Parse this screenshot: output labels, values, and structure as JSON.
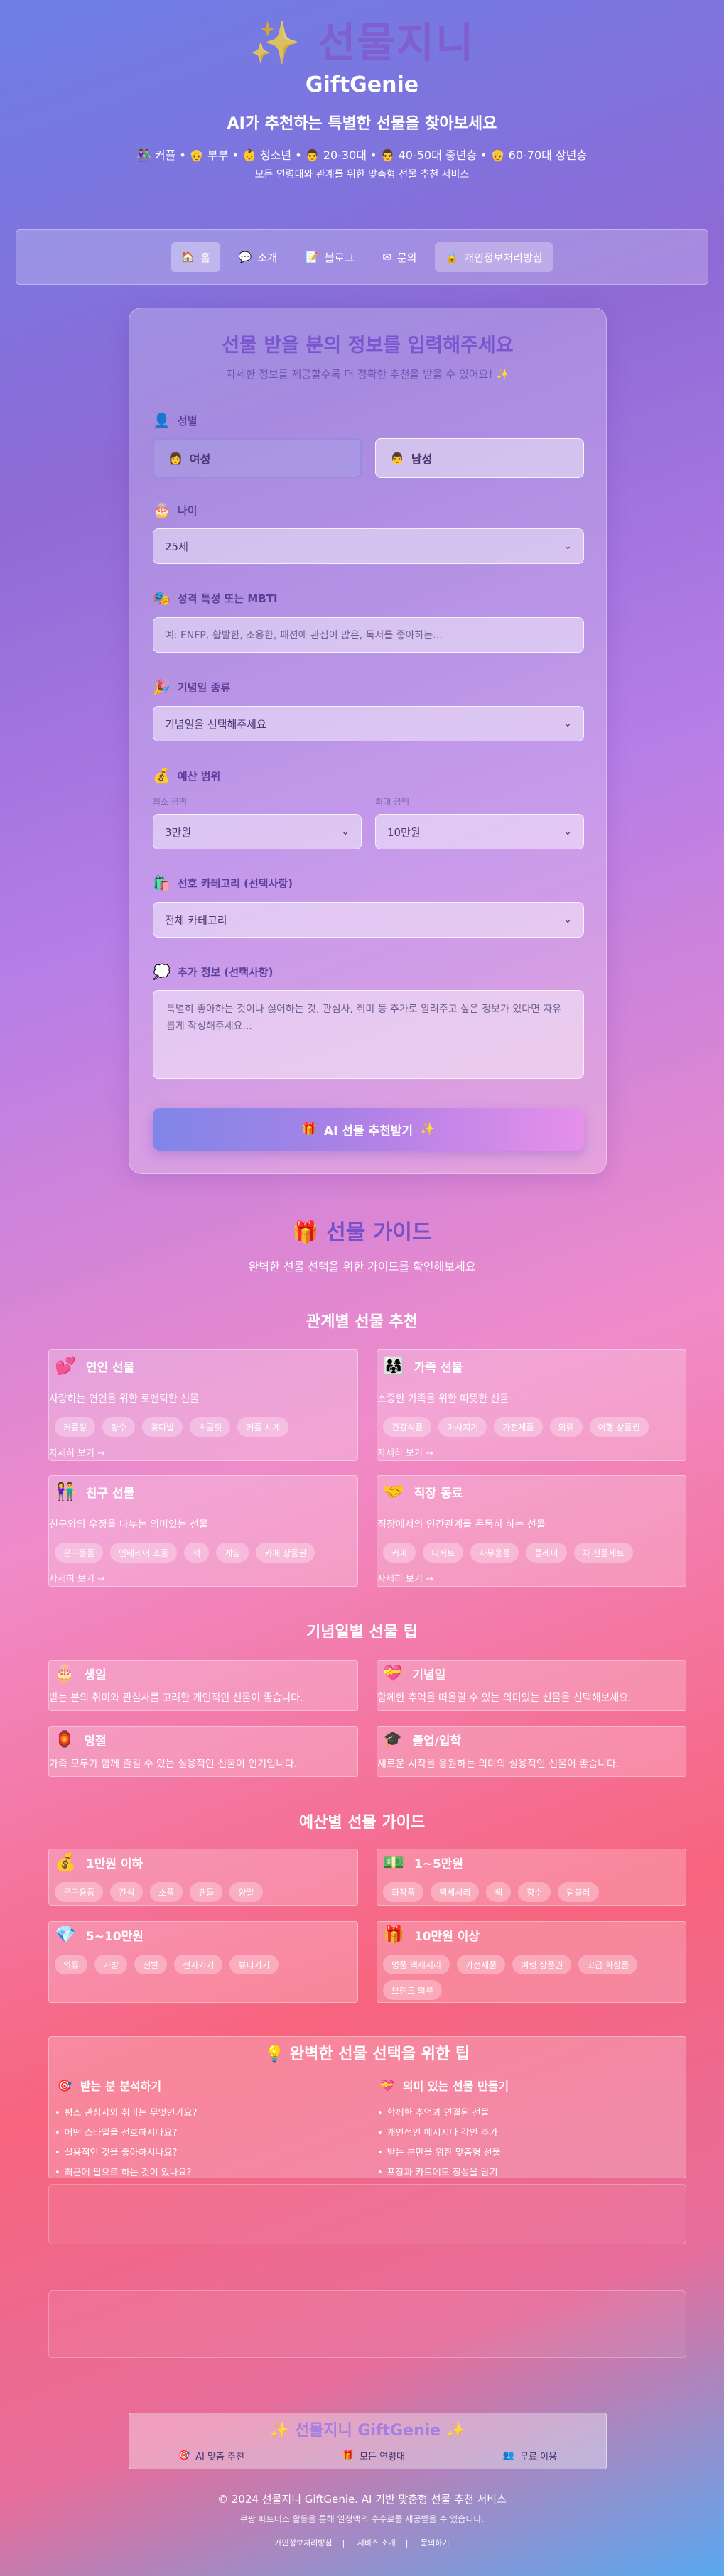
{
  "header": {
    "title": "선물지니",
    "subtitle": "GiftGenie",
    "tagline": "AI가 추천하는 특별한 선물을 찾아보세요",
    "targets": "👫 커플 • 👴 부부 • 👶 청소년 • 👨 20-30대 • 👨 40-50대 중년층 • 👴 60-70대 장년층",
    "targets_desc": "모든 연령대와 관계를 위한 맞춤형 선물 추천 서비스"
  },
  "nav": [
    {
      "icon": "🏠",
      "label": "홈"
    },
    {
      "icon": "💬",
      "label": "소개"
    },
    {
      "icon": "📝",
      "label": "블로그"
    },
    {
      "icon": "✉",
      "label": "문의"
    },
    {
      "icon": "🔒",
      "label": "개인정보처리방침"
    }
  ],
  "form": {
    "title": "선물 받을 분의 정보를 입력해주세요",
    "subtitle": "자세한 정보를 제공할수록 더 정확한 추천을 받을 수 있어요! ✨",
    "gender_label": "성별",
    "gender_female": "여성",
    "gender_male": "남성",
    "age_label": "나이",
    "age_value": "25세",
    "mbti_label": "성격 특성 또는 MBTI",
    "mbti_placeholder": "예: ENFP, 활발한, 조용한, 패션에 관심이 많은, 독서를 좋아하는...",
    "occasion_label": "기념일 종류",
    "occasion_value": "기념일을 선택해주세요",
    "budget_label": "예산 범위",
    "budget_min_label": "최소 금액",
    "budget_min_value": "3만원",
    "budget_max_label": "최대 금액",
    "budget_max_value": "10만원",
    "category_label": "선호 카테고리 (선택사항)",
    "category_value": "전체 카테고리",
    "extra_label": "추가 정보 (선택사항)",
    "extra_placeholder": "특별히 좋아하는 것이나 싫어하는 것, 관심사, 취미 등 추가로 알려주고 싶은 정보가 있다면 자유롭게 작성해주세요...",
    "submit_label": "AI 선물 추천받기"
  },
  "guide": {
    "title": "선물 가이드",
    "subtitle": "완벽한 선물 선택을 위한 가이드를 확인해보세요",
    "relation_title": "관계별 선물 추천",
    "relations": [
      {
        "icon": "💕",
        "name": "연인 선물",
        "desc": "사랑하는 연인을 위한 로맨틱한 선물",
        "tags": [
          "커플링",
          "향수",
          "꽃다발",
          "초콜릿",
          "커플 시계"
        ],
        "more": "자세히 보기 →"
      },
      {
        "icon": "👨‍👩‍👧",
        "name": "가족 선물",
        "desc": "소중한 가족을 위한 따뜻한 선물",
        "tags": [
          "건강식품",
          "마사지기",
          "가전제품",
          "의류",
          "여행 상품권"
        ],
        "more": "자세히 보기 →"
      },
      {
        "icon": "👫",
        "name": "친구 선물",
        "desc": "친구와의 우정을 나누는 의미있는 선물",
        "tags": [
          "문구용품",
          "인테리어 소품",
          "책",
          "게임",
          "카페 상품권"
        ],
        "more": "자세히 보기 →"
      },
      {
        "icon": "🤝",
        "name": "직장 동료",
        "desc": "직장에서의 인간관계를 돈독히 하는 선물",
        "tags": [
          "커피",
          "디저트",
          "사무용품",
          "플레너",
          "차 선물세트"
        ],
        "more": "자세히 보기 →"
      }
    ],
    "occasion_title": "기념일별 선물 팁",
    "occasions": [
      {
        "icon": "🎂",
        "name": "생일",
        "desc": "받는 분의 취미와 관심사를 고려한 개인적인 선물이 좋습니다."
      },
      {
        "icon": "💝",
        "name": "기념일",
        "desc": "함께한 추억을 떠올릴 수 있는 의미있는 선물을 선택해보세요."
      },
      {
        "icon": "🏮",
        "name": "명절",
        "desc": "가족 모두가 함께 즐길 수 있는 실용적인 선물이 인기입니다."
      },
      {
        "icon": "🎓",
        "name": "졸업/입학",
        "desc": "새로운 시작을 응원하는 의미의 실용적인 선물이 좋습니다."
      }
    ],
    "budget_title": "예산별 선물 가이드",
    "budgets": [
      {
        "icon": "💰",
        "name": "1만원 이하",
        "tags": [
          "문구용품",
          "간식",
          "소품",
          "캔들",
          "양말"
        ]
      },
      {
        "icon": "💵",
        "name": "1~5만원",
        "tags": [
          "화장품",
          "액세서리",
          "책",
          "향수",
          "텀블러"
        ]
      },
      {
        "icon": "💎",
        "name": "5~10만원",
        "tags": [
          "의류",
          "가방",
          "신발",
          "전자기기",
          "뷰티기기"
        ]
      },
      {
        "icon": "🎁",
        "name": "10만원 이상",
        "tags": [
          "명품 액세서리",
          "가전제품",
          "여행 상품권",
          "고급 화장품",
          "브랜드 의류"
        ]
      }
    ],
    "tips_title": "완벽한 선물 선택을 위한 팁",
    "tips_left_title": "받는 분 분석하기",
    "tips_left": [
      "평소 관심사와 취미는 무엇인가요?",
      "어떤 스타일을 선호하시나요?",
      "실용적인 것을 좋아하시나요?",
      "최근에 필요로 하는 것이 있나요?"
    ],
    "tips_right_title": "의미 있는 선물 만들기",
    "tips_right": [
      "함께한 추억과 연결된 선물",
      "개인적인 메시지나 각인 추가",
      "받는 분만을 위한 맞춤형 선물",
      "포장과 카드에도 정성을 담기"
    ]
  },
  "footer": {
    "title": "선물지니 GiftGenie",
    "links": [
      {
        "icon": "🎯",
        "label": "AI 맞춤 추천"
      },
      {
        "icon": "🎁",
        "label": "모든 연령대"
      },
      {
        "icon": "👥",
        "label": "무료 이용"
      }
    ],
    "copyright": "© 2024 선물지니 GiftGenie. AI 기반 맞춤형 선물 추천 서비스",
    "partner": "쿠팡 파트너스 활동을 통해 일정액의 수수료를 제공받을 수 있습니다.",
    "bottom_links": [
      "개인정보처리방침",
      "서비스 소개",
      "문의하기"
    ]
  },
  "colors": {
    "accent": "#7a55d0",
    "brand_title": "#8258c9"
  }
}
